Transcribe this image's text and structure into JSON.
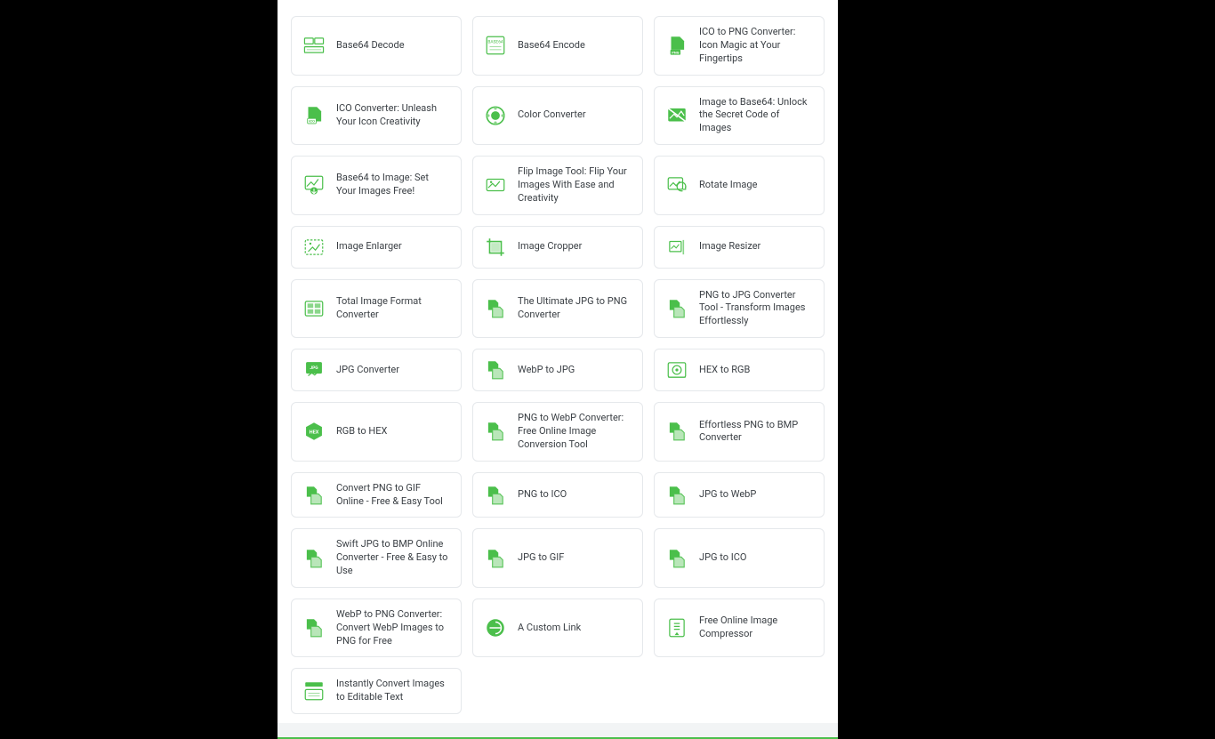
{
  "tools": [
    {
      "icon": "base64-decode",
      "label": "Base64 Decode"
    },
    {
      "icon": "base64-encode",
      "label": "Base64 Encode"
    },
    {
      "icon": "ico-png",
      "label": "ICO to PNG Converter: Icon Magic at Your Fingertips"
    },
    {
      "icon": "ico-convert",
      "label": "ICO Converter: Unleash Your Icon Creativity"
    },
    {
      "icon": "color-convert",
      "label": "Color Converter"
    },
    {
      "icon": "img-base64",
      "label": "Image to Base64: Unlock the Secret Code of Images"
    },
    {
      "icon": "base64-img",
      "label": "Base64 to Image: Set Your Images Free!"
    },
    {
      "icon": "flip-img",
      "label": "Flip Image Tool: Flip Your Images With Ease and Creativity"
    },
    {
      "icon": "rotate-img",
      "label": "Rotate Image"
    },
    {
      "icon": "enlarge",
      "label": "Image Enlarger"
    },
    {
      "icon": "cropper",
      "label": "Image Cropper"
    },
    {
      "icon": "resizer",
      "label": "Image Resizer"
    },
    {
      "icon": "total-fmt",
      "label": "Total Image Format Converter"
    },
    {
      "icon": "jpg-png",
      "label": "The Ultimate JPG to PNG Converter"
    },
    {
      "icon": "png-jpg",
      "label": "PNG to JPG Converter Tool - Transform Images Effortlessly"
    },
    {
      "icon": "jpg-conv",
      "label": "JPG Converter"
    },
    {
      "icon": "webp-jpg",
      "label": "WebP to JPG"
    },
    {
      "icon": "hex-rgb",
      "label": "HEX to RGB"
    },
    {
      "icon": "rgb-hex",
      "label": "RGB to HEX"
    },
    {
      "icon": "png-webp",
      "label": "PNG to WebP Converter: Free Online Image Conversion Tool"
    },
    {
      "icon": "png-bmp",
      "label": "Effortless PNG to BMP Converter"
    },
    {
      "icon": "png-gif",
      "label": "Convert PNG to GIF Online - Free & Easy Tool"
    },
    {
      "icon": "png-ico",
      "label": "PNG to ICO"
    },
    {
      "icon": "jpg-webp",
      "label": "JPG to WebP"
    },
    {
      "icon": "jpg-bmp",
      "label": "Swift JPG to BMP Online Converter - Free & Easy to Use"
    },
    {
      "icon": "jpg-gif",
      "label": "JPG to GIF"
    },
    {
      "icon": "jpg-ico",
      "label": "JPG to ICO"
    },
    {
      "icon": "webp-png",
      "label": "WebP to PNG Converter: Convert WebP Images to PNG for Free"
    },
    {
      "icon": "custom-link",
      "label": "A Custom Link"
    },
    {
      "icon": "compress",
      "label": "Free Online Image Compressor"
    },
    {
      "icon": "ocr",
      "label": "Instantly Convert Images to Editable Text"
    }
  ]
}
